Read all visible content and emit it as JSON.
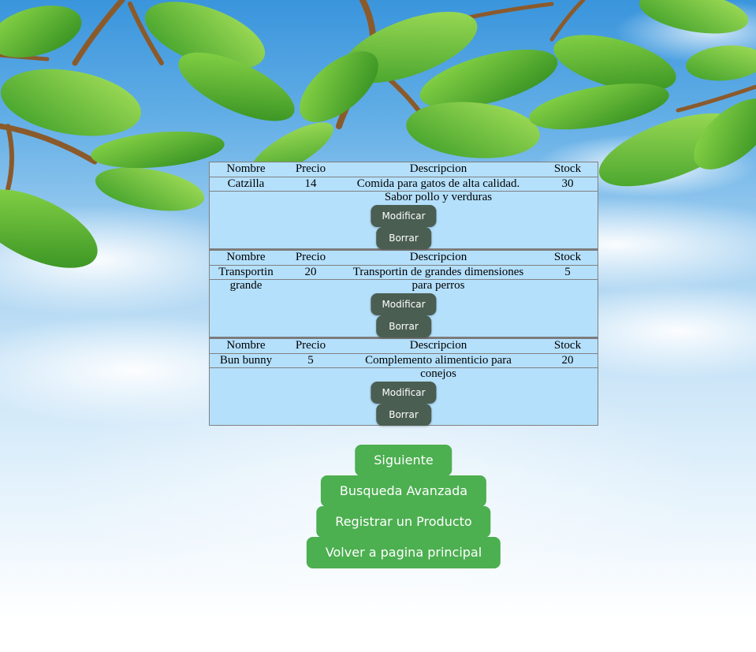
{
  "table_headers": {
    "name": "Nombre",
    "price": "Precio",
    "description": "Descripcion",
    "stock": "Stock"
  },
  "products": [
    {
      "name_line1": "Catzilla",
      "name_line2": "",
      "price": "14",
      "desc_line1": "Comida para gatos de alta calidad.",
      "desc_line2": "Sabor pollo y verduras",
      "stock": "30",
      "modify_label": "Modificar",
      "delete_label": "Borrar"
    },
    {
      "name_line1": "Transportin",
      "name_line2": "grande",
      "price": "20",
      "desc_line1": "Transportin de grandes dimensiones",
      "desc_line2": "para perros",
      "stock": "5",
      "modify_label": "Modificar",
      "delete_label": "Borrar"
    },
    {
      "name_line1": "Bun bunny",
      "name_line2": "",
      "price": "5",
      "desc_line1": "Complemento alimenticio para",
      "desc_line2": "conejos",
      "stock": "20",
      "modify_label": "Modificar",
      "delete_label": "Borrar"
    }
  ],
  "actions": {
    "next_label": "Siguiente",
    "advanced_search_label": "Busqueda Avanzada",
    "register_product_label": "Registrar un Producto",
    "back_home_label": "Volver a pagina principal"
  },
  "colors": {
    "panel_bg": "#b4e0fc",
    "small_button": "#4a5e52",
    "big_button": "#4caf50"
  }
}
